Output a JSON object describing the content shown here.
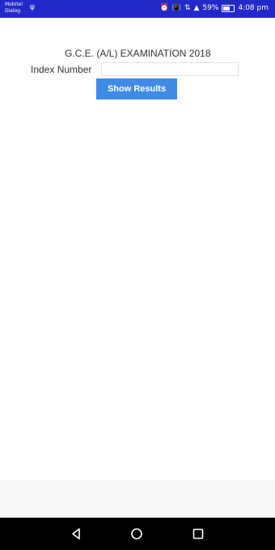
{
  "status_bar": {
    "carrier_text": "Mobitel Dialog",
    "usb_icon": "usb-icon",
    "icons": [
      "alarm-icon",
      "vibrate-icon",
      "data-icon",
      "signal-icon"
    ],
    "battery_percent": "59%",
    "battery_level": 0.59,
    "time": "4:08 pm",
    "background": "#2329c9"
  },
  "page": {
    "title": "G.C.E. (A/L) EXAMINATION 2018",
    "index_label": "Index Number",
    "index_value": "",
    "show_button_label": "Show Results",
    "button_color": "#3f8be6"
  },
  "nav_bar": {
    "icons": [
      "back-icon",
      "home-icon",
      "recent-apps-icon"
    ]
  }
}
